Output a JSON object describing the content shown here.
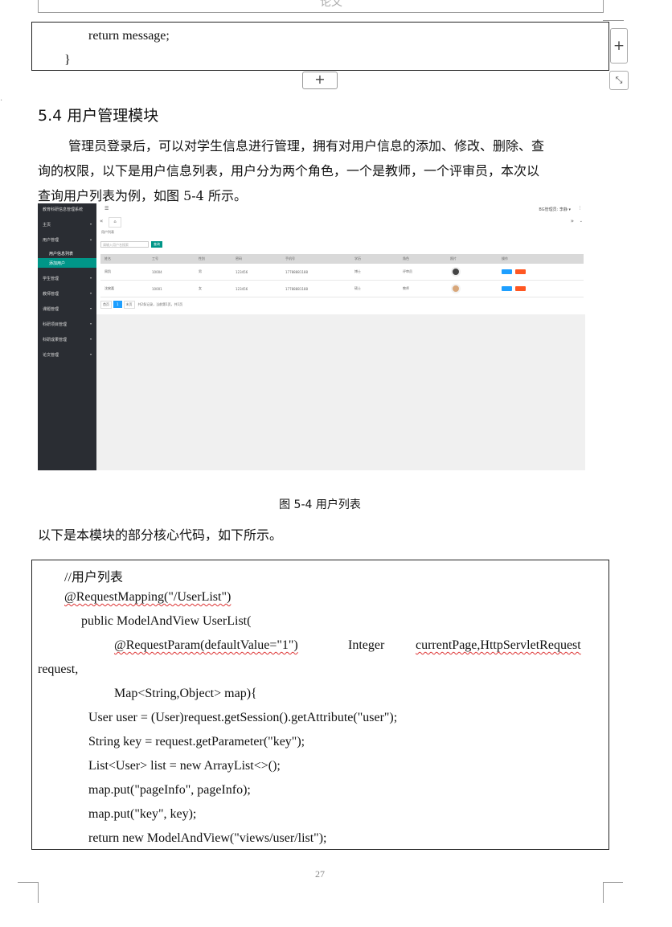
{
  "header": {
    "text": "论文"
  },
  "code_top": {
    "lines": [
      "return message;",
      "}"
    ]
  },
  "plus_label": "+",
  "section": {
    "title": "5.4 用户管理模块"
  },
  "paragraph": {
    "lines": [
      "管理员登录后，可以对学生信息进行管理，拥有对用户信息的添加、修改、删除、查",
      "询的权限，以下是用户信息列表，用户分为两个角色，一个是教师，一个评审员，本次以",
      "查询用户列表为例，如图 5-4 所示。"
    ]
  },
  "screenshot": {
    "app_title": "教育科研信息管理系统",
    "user_menu": "BG管理员: 李静 ▾",
    "breadcrumb": "用户列表",
    "search_placeholder": "请输入用户名搜索",
    "search_button": "查询",
    "sidebar": [
      {
        "label": "主页"
      },
      {
        "label": "用户管理"
      },
      {
        "label": "学生管理"
      },
      {
        "label": "教师管理"
      },
      {
        "label": "课题管理"
      },
      {
        "label": "科研项目管理"
      },
      {
        "label": "科研成果管理"
      },
      {
        "label": "论文管理"
      }
    ],
    "sidebar_sub": [
      "用户信息列表",
      "添加用户"
    ],
    "columns": [
      "姓名",
      "工号",
      "性别",
      "密码",
      "手机号",
      "学历",
      "角色",
      "照片",
      "操作"
    ],
    "rows": [
      [
        "周凯",
        "10004",
        "男",
        "123456",
        "17788881188",
        "博士",
        "评审员"
      ],
      [
        "沈婉嘉",
        "10001",
        "女",
        "123456",
        "17788881188",
        "硕士",
        "教师"
      ]
    ],
    "row_buttons": [
      "修改",
      "删除"
    ],
    "pagination": {
      "first": "首页",
      "current": "1",
      "last": "末页",
      "info": "共2条记录，当前第1页，共1页"
    }
  },
  "caption": "图 5-4 用户列表",
  "intro": "以下是本模块的部分核心代码，如下所示。",
  "code_main": {
    "l1": "//用户列表",
    "l2": "@RequestMapping(\"/UserList\")",
    "l3": "public ModelAndView UserList(",
    "l4a": "@RequestParam(defaultValue=\"1\")",
    "l4b": "Integer",
    "l4c": "currentPage,HttpServletRequest",
    "l5": "request,",
    "l6": "Map<String,Object> map){",
    "l7": "User user = (User)request.getSession().getAttribute(\"user\");",
    "l8": "String key = request.getParameter(\"key\");",
    "l9": "List<User> list = new ArrayList<>();",
    "l10": "map.put(\"pageInfo\", pageInfo);",
    "l11": "map.put(\"key\", key);",
    "l12": "return new ModelAndView(\"views/user/list\");"
  },
  "page_number": "27",
  "colors": {
    "accent_teal": "#009688",
    "sidebar": "#2a2d33",
    "btn_blue": "#1e9fff",
    "btn_red": "#ff5722"
  }
}
